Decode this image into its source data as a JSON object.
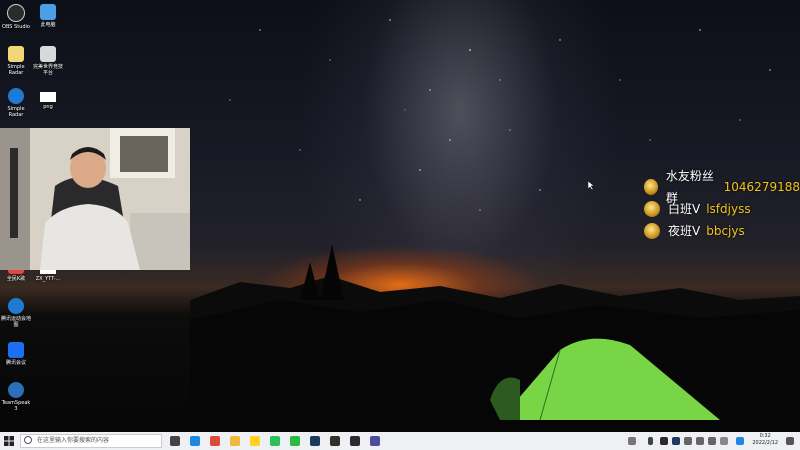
{
  "desktop": {
    "icons": [
      {
        "label": "OBS Studio",
        "icon": "obs-icon",
        "color": "#2b2b2b"
      },
      {
        "label": "此电脑",
        "icon": "computer-icon",
        "color": "#4a9fe8"
      },
      {
        "label": "Simple Radar",
        "icon": "file-icon",
        "color": "#f3d777"
      },
      {
        "label": "完美世界竞技平台",
        "icon": "game-platform-icon",
        "color": "#d9d9d9"
      },
      {
        "label": "Simple Radar",
        "icon": "zip-icon",
        "color": "#1f7ad6"
      },
      {
        "label": "png",
        "icon": "image-file-icon",
        "color": "#ffffff"
      },
      {
        "label": "全民K歌",
        "icon": "app-icon",
        "color": "#e8453c"
      },
      {
        "label": "ZX_YTT-...",
        "icon": "file-icon",
        "color": "#ffffff"
      },
      {
        "label": "腾讯运动会地图",
        "icon": "zip-icon",
        "color": "#1f7ad6"
      },
      {
        "label": "腾讯会议",
        "icon": "meeting-icon",
        "color": "#1d6ff2"
      },
      {
        "label": "TeamSpeak 3",
        "icon": "teamspeak-icon",
        "color": "#2a6fb8"
      }
    ]
  },
  "overlay": {
    "rows": [
      {
        "label": "水友粉丝群",
        "value": "1046279188"
      },
      {
        "label": "白班V",
        "value": "lsfdjyss"
      },
      {
        "label": "夜班V",
        "value": "bbcjys"
      }
    ],
    "accent": "#f0c419"
  },
  "taskbar": {
    "search_placeholder": "在这里输入你要搜索的内容",
    "time": "0:32",
    "date": "2022/2/12",
    "apps": [
      {
        "icon": "task-view-icon",
        "color": "#444444"
      },
      {
        "icon": "edge-icon",
        "color": "#1e88e5"
      },
      {
        "icon": "chrome-icon",
        "color": "#e04a3a"
      },
      {
        "icon": "file-explorer-icon",
        "color": "#f0b93c"
      },
      {
        "icon": "qq-icon",
        "color": "#ffd21f"
      },
      {
        "icon": "qq-music-icon",
        "color": "#2fbf5a"
      },
      {
        "icon": "wechat-icon",
        "color": "#2dbb3f"
      },
      {
        "icon": "steam-icon",
        "color": "#1b3a5c"
      },
      {
        "icon": "csgo-icon",
        "color": "#33302a"
      },
      {
        "icon": "obs-icon",
        "color": "#2b2b2b"
      },
      {
        "icon": "radar-icon",
        "color": "#4a4f9a"
      }
    ]
  }
}
